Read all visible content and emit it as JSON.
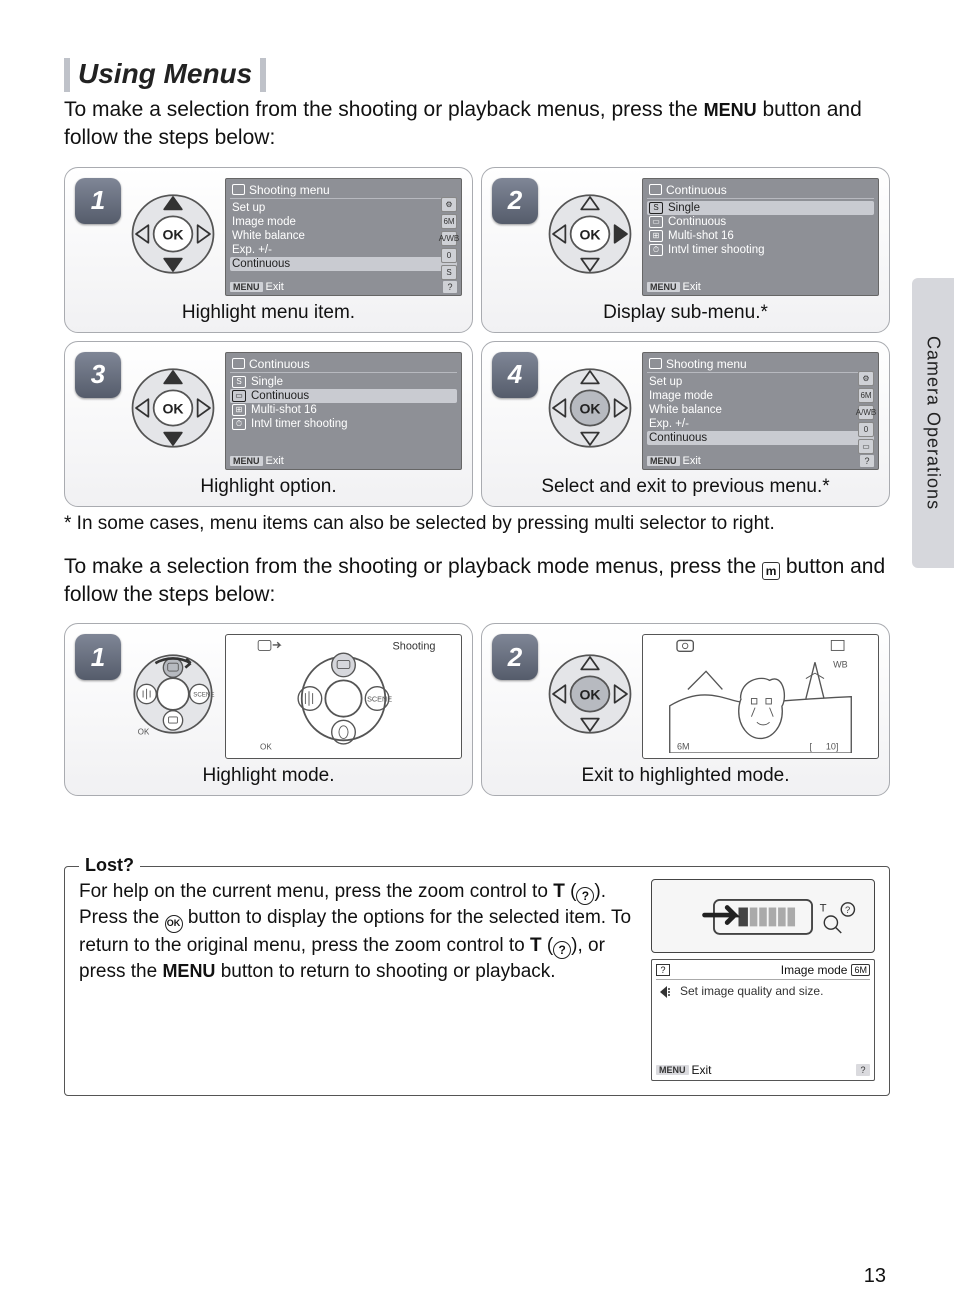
{
  "section_title": "Using Menus",
  "intro_1a": "To make a selection from the shooting or playback menus, press the ",
  "intro_1_menu": "MENU",
  "intro_1b": " button and follow the steps below:",
  "steps1": [
    {
      "num": "1",
      "caption": "Highlight menu item.",
      "screen": {
        "title": "Shooting menu",
        "rows": [
          {
            "label": "Set up",
            "sel": false
          },
          {
            "label": "Image mode",
            "sel": false
          },
          {
            "label": "White balance",
            "sel": false
          },
          {
            "label": "Exp. +/-",
            "sel": false
          },
          {
            "label": "Continuous",
            "sel": true
          }
        ],
        "badges": [
          "⚙",
          "6M",
          "A/WB",
          "0",
          "S"
        ],
        "foot_menu": "MENU",
        "foot_exit": "Exit",
        "help": "?"
      },
      "dir": "ud"
    },
    {
      "num": "2",
      "caption": "Display sub-menu.*",
      "screen": {
        "title": "Continuous",
        "rows": [
          {
            "ico": "S",
            "label": "Single",
            "sel": true
          },
          {
            "ico": "▭",
            "label": "Continuous",
            "sel": false
          },
          {
            "ico": "⊞",
            "label": "Multi-shot 16",
            "sel": false
          },
          {
            "ico": "⏱",
            "label": "Intvl timer shooting",
            "sel": false
          }
        ],
        "foot_menu": "MENU",
        "foot_exit": "Exit"
      },
      "dir": "r"
    },
    {
      "num": "3",
      "caption": "Highlight option.",
      "screen": {
        "title": "Continuous",
        "rows": [
          {
            "ico": "S",
            "label": "Single",
            "sel": false
          },
          {
            "ico": "▭",
            "label": "Continuous",
            "sel": true
          },
          {
            "ico": "⊞",
            "label": "Multi-shot 16",
            "sel": false
          },
          {
            "ico": "⏱",
            "label": "Intvl timer shooting",
            "sel": false
          }
        ],
        "foot_menu": "MENU",
        "foot_exit": "Exit"
      },
      "dir": "ud"
    },
    {
      "num": "4",
      "caption": "Select and exit to previous menu.*",
      "screen": {
        "title": "Shooting menu",
        "rows": [
          {
            "label": "Set up",
            "sel": false
          },
          {
            "label": "Image mode",
            "sel": false
          },
          {
            "label": "White balance",
            "sel": false
          },
          {
            "label": "Exp. +/-",
            "sel": false
          },
          {
            "label": "Continuous",
            "sel": true
          }
        ],
        "badges": [
          "⚙",
          "6M",
          "A/WB",
          "0",
          "▭"
        ],
        "foot_menu": "MENU",
        "foot_exit": "Exit",
        "help": "?"
      },
      "dir": "ok"
    }
  ],
  "footnote": "*  In some cases, menu items can also be selected by pressing multi selector to right.",
  "intro_2a": "To make a selection from the shooting or playback mode menus, press the ",
  "intro_2_icon": "m",
  "intro_2b": " button and follow the steps below:",
  "steps2": [
    {
      "num": "1",
      "caption": "Highlight mode.",
      "dir": "dial",
      "label": "Shooting"
    },
    {
      "num": "2",
      "caption": "Exit to highlighted mode.",
      "dir": "ok"
    }
  ],
  "lost": {
    "title": "Lost?",
    "text_parts": {
      "a": "For help on the current menu, press the zoom control to ",
      "t1": "T",
      "b": " (",
      "c": ").  Press the ",
      "d": " button to display the options for the selected item.  To return to the original menu, press the zoom control to ",
      "t2": "T",
      "e": " (",
      "f": "), or press the ",
      "menu": "MENU",
      "g": " button to return to shooting or playback."
    },
    "screen": {
      "q": "?",
      "title": "Image mode",
      "pill": "6M",
      "desc": "Set image quality and size.",
      "foot_menu": "MENU",
      "foot_exit": "Exit",
      "help": "?"
    }
  },
  "sidebar": "Camera Operations",
  "page_number": "13",
  "ok_label": "OK"
}
